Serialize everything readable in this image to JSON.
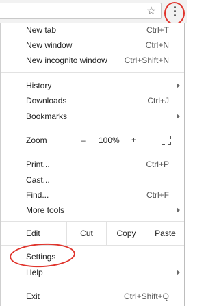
{
  "toolbar": {
    "star_icon": "star-outline",
    "menu_icon": "vertical-ellipsis",
    "highlight_color": "#e0342c"
  },
  "menu": {
    "new_tab": {
      "label": "New tab",
      "shortcut": "Ctrl+T"
    },
    "new_window": {
      "label": "New window",
      "shortcut": "Ctrl+N"
    },
    "new_incognito": {
      "label": "New incognito window",
      "shortcut": "Ctrl+Shift+N"
    },
    "history": {
      "label": "History"
    },
    "downloads": {
      "label": "Downloads",
      "shortcut": "Ctrl+J"
    },
    "bookmarks": {
      "label": "Bookmarks"
    },
    "zoom": {
      "label": "Zoom",
      "minus": "–",
      "value": "100%",
      "plus": "+"
    },
    "print": {
      "label": "Print...",
      "shortcut": "Ctrl+P"
    },
    "cast": {
      "label": "Cast..."
    },
    "find": {
      "label": "Find...",
      "shortcut": "Ctrl+F"
    },
    "more_tools": {
      "label": "More tools"
    },
    "edit": {
      "label": "Edit",
      "cut": "Cut",
      "copy": "Copy",
      "paste": "Paste"
    },
    "settings": {
      "label": "Settings"
    },
    "help": {
      "label": "Help"
    },
    "exit": {
      "label": "Exit",
      "shortcut": "Ctrl+Shift+Q"
    }
  }
}
